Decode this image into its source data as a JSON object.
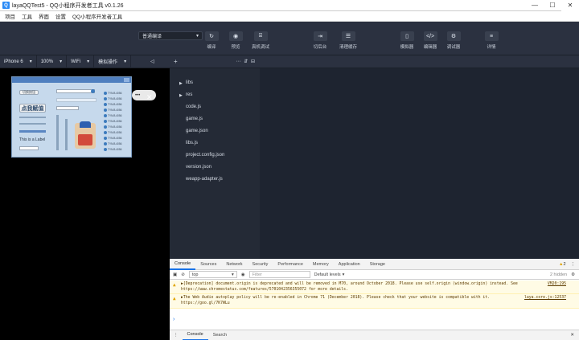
{
  "window": {
    "title": "layaQQTest5 - QQ小程序开发者工具 v0.1.26",
    "minimize": "—",
    "maximize": "☐",
    "close": "✕"
  },
  "menu": [
    "项目",
    "工具",
    "界面",
    "设置",
    "QQ小程序开发者工具"
  ],
  "toolbar": {
    "compile_mode": "普通编译",
    "buttons": [
      {
        "label": "编译",
        "icon": "↻"
      },
      {
        "label": "预览",
        "icon": "◉"
      },
      {
        "label": "真机调试",
        "icon": "⌸"
      },
      {
        "label": "切后台",
        "icon": "⇥"
      },
      {
        "label": "清理缓存",
        "icon": "☰"
      },
      {
        "label": "模拟器",
        "icon": "▯"
      },
      {
        "label": "编辑器",
        "icon": "</>"
      },
      {
        "label": "调试器",
        "icon": "⚙"
      },
      {
        "label": "详情",
        "icon": "≡"
      }
    ]
  },
  "simulator": {
    "device": "iPhone 6",
    "zoom": "100%",
    "network": "WiFi",
    "operation": "模拟操作",
    "game_text": {
      "big_button": "点我赋值",
      "label": "This is a Label",
      "small_button": "切换按钮"
    }
  },
  "file_tree": [
    {
      "name": "libs",
      "folder": true
    },
    {
      "name": "res",
      "folder": true
    },
    {
      "name": "code.js",
      "folder": false
    },
    {
      "name": "game.js",
      "folder": false
    },
    {
      "name": "game.json",
      "folder": false
    },
    {
      "name": "libs.js",
      "folder": false
    },
    {
      "name": "project.config.json",
      "folder": false
    },
    {
      "name": "version.json",
      "folder": false
    },
    {
      "name": "weapp-adapter.js",
      "folder": false
    }
  ],
  "devtools": {
    "tabs": [
      "Console",
      "Sources",
      "Network",
      "Security",
      "Performance",
      "Memory",
      "Application",
      "Storage"
    ],
    "warning_count": "2",
    "context": "top",
    "filter_placeholder": "Filter",
    "levels": "Default levels",
    "hidden": "2 hidden",
    "messages": [
      {
        "text": "▶[Deprecation] document.origin is deprecated and will be removed in M70, around October 2018. Please use self.origin (window.origin) instead. See https://www.chromestatus.com/features/5701042356355072 for more details.",
        "source": "VM20:195"
      },
      {
        "text": "▶The Web Audio autoplay policy will be re-enabled in Chrome 71 (December 2018). Please check that your website is compatible with it. https://goo.gl/7K7WLu",
        "source": "laya.core.js:12537"
      }
    ],
    "prompt": "›",
    "drawer_tabs": [
      "Console",
      "Search"
    ]
  }
}
